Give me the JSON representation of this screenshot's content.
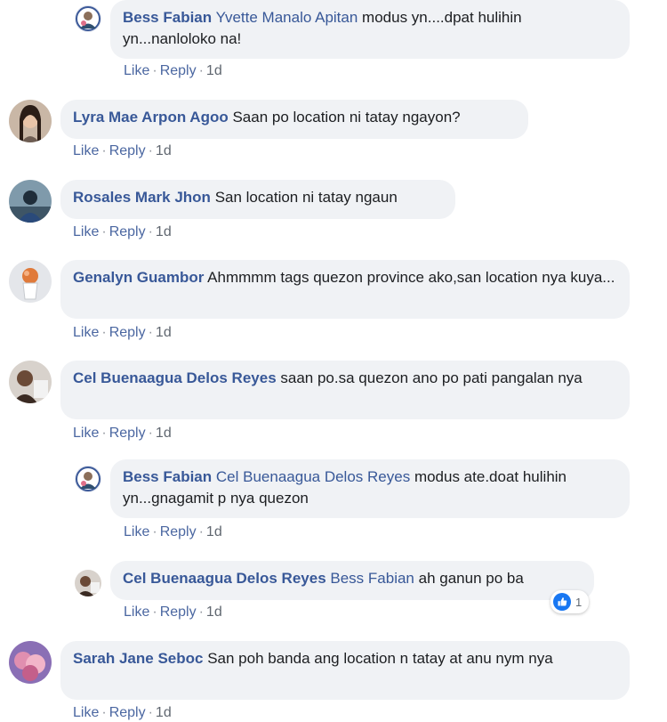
{
  "comments": [
    {
      "author": "Bess Fabian",
      "mention": "Yvette Manalo Apitan",
      "text": "modus yn....dpat hulihin yn...nanloloko na!",
      "actions": {
        "like": "Like",
        "reply": "Reply",
        "time": "1d"
      },
      "reply": true
    },
    {
      "author": "Lyra Mae Arpon Agoo",
      "mention": "",
      "text": "Saan po location ni tatay ngayon?",
      "actions": {
        "like": "Like",
        "reply": "Reply",
        "time": "1d"
      }
    },
    {
      "author": "Rosales Mark Jhon",
      "mention": "",
      "text": "San location ni tatay ngaun",
      "actions": {
        "like": "Like",
        "reply": "Reply",
        "time": "1d"
      }
    },
    {
      "author": "Genalyn Guambor",
      "mention": "",
      "text": "Ahmmmm tags quezon province ako,san location nya kuya...",
      "actions": {
        "like": "Like",
        "reply": "Reply",
        "time": "1d"
      }
    },
    {
      "author": "Cel Buenaagua Delos Reyes",
      "mention": "",
      "text": "saan po.sa quezon ano po pati pangalan nya",
      "actions": {
        "like": "Like",
        "reply": "Reply",
        "time": "1d"
      }
    },
    {
      "author": "Bess Fabian",
      "mention": "Cel Buenaagua Delos Reyes",
      "text": "modus ate.doat hulihin yn...gnagamit p nya quezon",
      "actions": {
        "like": "Like",
        "reply": "Reply",
        "time": "1d"
      },
      "reply": true
    },
    {
      "author": "Cel Buenaagua Delos Reyes",
      "mention": "Bess Fabian",
      "text": "ah ganun po ba",
      "actions": {
        "like": "Like",
        "reply": "Reply",
        "time": "1d"
      },
      "reaction_count": "1",
      "reply": true
    },
    {
      "author": "Sarah Jane Seboc",
      "mention": "",
      "text": "San poh banda ang location n tatay at anu nym nya",
      "actions": {
        "like": "Like",
        "reply": "Reply",
        "time": "1d"
      }
    }
  ],
  "colors": {
    "link": "#385898",
    "bubble": "#f0f2f5",
    "like_blue": "#1877f2"
  },
  "icons": {
    "reaction": "thumbs-up-icon"
  }
}
